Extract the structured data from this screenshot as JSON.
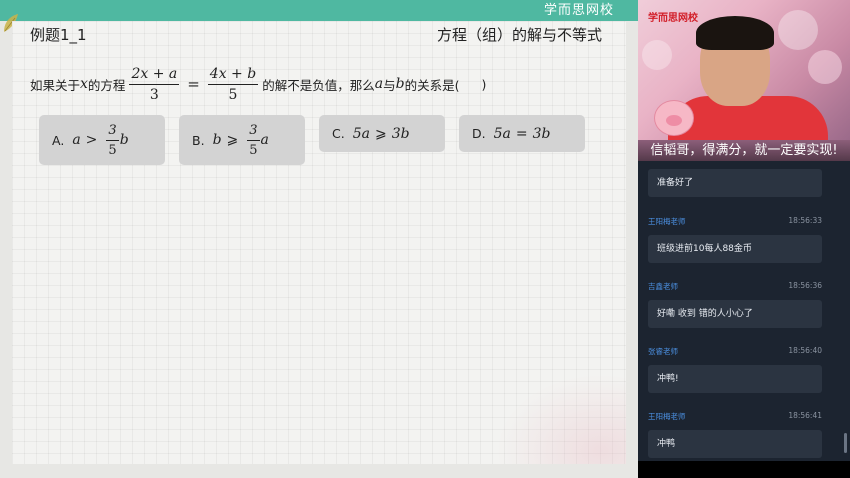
{
  "header": {
    "brand": "学而思网校"
  },
  "slide": {
    "example_title": "例题1_1",
    "topic": "方程（组）的解与不等式",
    "question": {
      "prefix": "如果关于",
      "var_x": "x",
      "mid1": "的方程",
      "frac1_num": "2x + a",
      "frac1_den": "3",
      "equals": "=",
      "frac2_num": "4x + b",
      "frac2_den": "5",
      "mid2": "的解不是负值，那么",
      "var_a": "a",
      "mid3": "与",
      "var_b": "b",
      "suffix": "的关系是(",
      "close": ")"
    },
    "options": [
      {
        "label": "A.",
        "lhs": "a",
        "op": ">",
        "num": "3",
        "den": "5",
        "rhs": "b"
      },
      {
        "label": "B.",
        "lhs": "b",
        "op": "⩾",
        "num": "3",
        "den": "5",
        "rhs": "a"
      },
      {
        "label": "C.",
        "expr_lhs": "5a",
        "op": "⩾",
        "expr_rhs": "3b"
      },
      {
        "label": "D.",
        "expr_lhs": "5a",
        "op": "=",
        "expr_rhs": "3b"
      }
    ]
  },
  "video": {
    "logo": "学而思网校",
    "caption": "信韬哥，得满分，就一定要实现!"
  },
  "chat": {
    "messages": [
      {
        "name": "",
        "time": "",
        "text": "准备好了"
      },
      {
        "name": "王阳梅老师",
        "time": "18:56:33",
        "text": "班级进前10每人88金币"
      },
      {
        "name": "吉鑫老师",
        "time": "18:56:36",
        "text": "好嘞 收到  错的人小心了"
      },
      {
        "name": "张睿老师",
        "time": "18:56:40",
        "text": "冲鸭!"
      },
      {
        "name": "王阳梅老师",
        "time": "18:56:41",
        "text": "冲鸭"
      }
    ]
  },
  "colors": {
    "accent_teal": "#4fb8a1",
    "option_bg": "#d3d3d3",
    "chat_bg": "#1c2430",
    "chat_name": "#4b8fe0",
    "chat_bubble": "#2b3441"
  }
}
